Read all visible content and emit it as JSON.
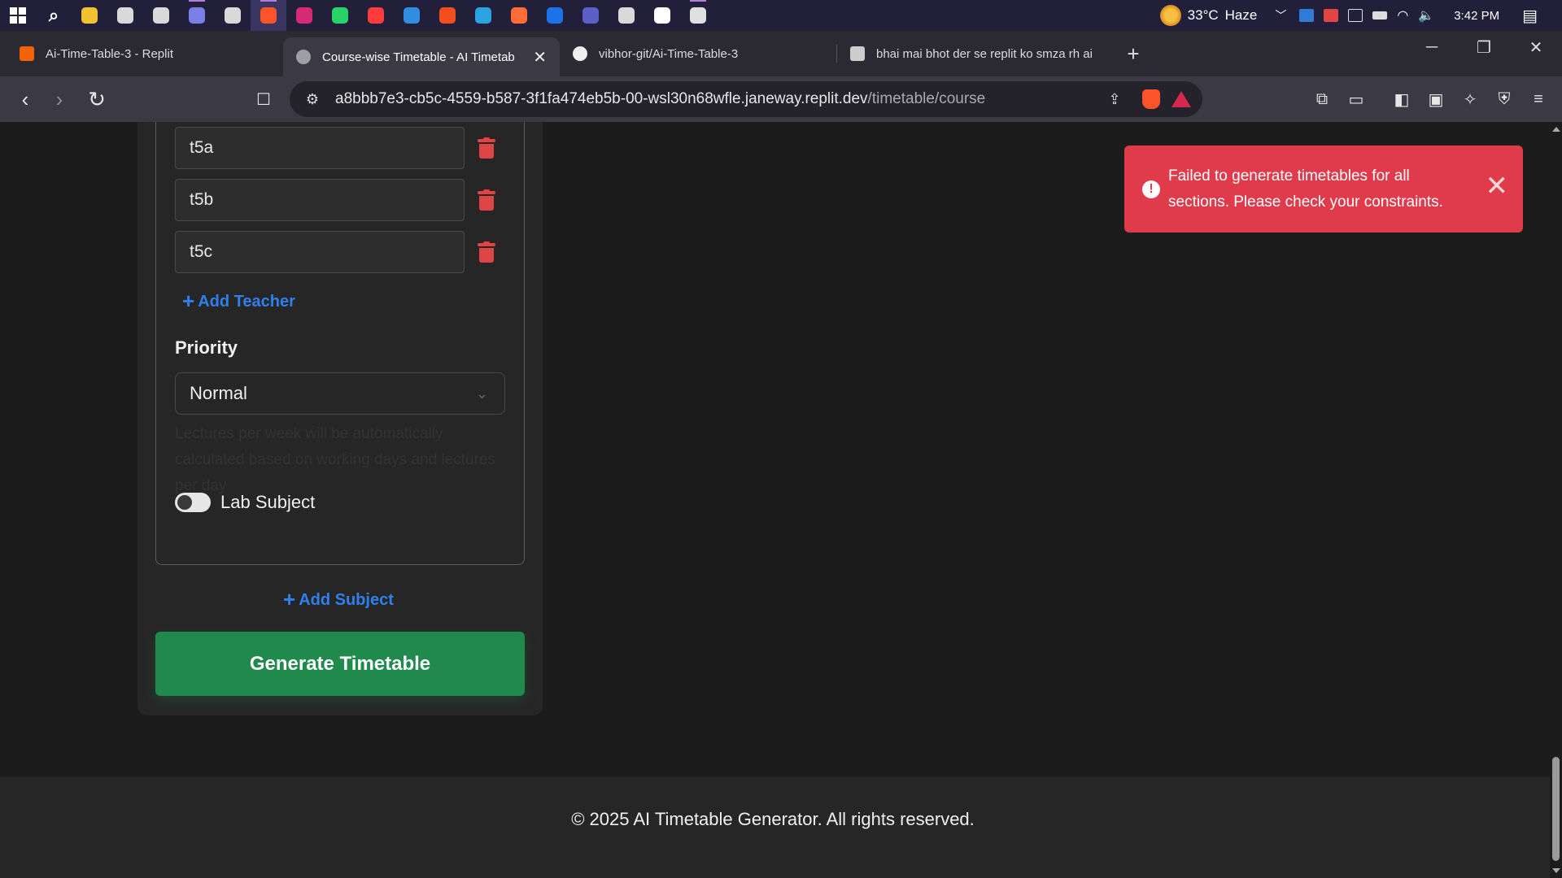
{
  "taskbar": {
    "apps": [
      {
        "name": "windows-start-icon"
      },
      {
        "name": "search-icon"
      },
      {
        "name": "file-explorer-icon",
        "color": "#f2c230"
      },
      {
        "name": "chatgpt-app-icon",
        "color": "#d9d9d9"
      },
      {
        "name": "copilot-app-icon",
        "color": "#d9d9d9"
      },
      {
        "name": "discord-app-icon",
        "color": "#7a7fe6"
      },
      {
        "name": "github-app-icon",
        "color": "#d9d9d9"
      },
      {
        "name": "brave-browser-icon",
        "color": "#fb542b"
      },
      {
        "name": "instagram-icon",
        "color": "#d62976"
      },
      {
        "name": "whatsapp-icon",
        "color": "#25d366"
      },
      {
        "name": "youtube-icon",
        "color": "#ff3b3b"
      },
      {
        "name": "vscode-icon",
        "color": "#2f8ee0"
      },
      {
        "name": "figma-icon",
        "color": "#f24e1e"
      },
      {
        "name": "telegram-icon",
        "color": "#2aa3e0"
      },
      {
        "name": "postman-icon",
        "color": "#ff6c37"
      },
      {
        "name": "outlook-icon",
        "color": "#1a73e8"
      },
      {
        "name": "teams-icon",
        "color": "#5b5fc7"
      },
      {
        "name": "copilot-web-icon",
        "color": "#d9d9d9"
      },
      {
        "name": "x-twitter-icon",
        "color": "#ffffff"
      },
      {
        "name": "git-icon",
        "color": "#e0e0e0"
      }
    ],
    "weather": {
      "temp": "33°C",
      "cond": "Haze"
    },
    "clock": "3:42 PM"
  },
  "tabs": [
    {
      "title": "Ai-Time-Table-3 - Replit",
      "fav_color": "#f26207",
      "icon": "replit-favicon"
    },
    {
      "title": "Course-wise Timetable - AI Timetab",
      "fav_color": "#9aa0a6",
      "icon": "globe-favicon",
      "close": "✕"
    },
    {
      "title": "vibhor-git/Ai-Time-Table-3",
      "fav_color": "#f0f0f0",
      "icon": "github-favicon"
    },
    {
      "title": "bhai mai bhot der se replit ko smza rh ai",
      "fav_color": "#cccccc",
      "icon": "chatgpt-favicon"
    }
  ],
  "new_tab": "+",
  "window_controls": {
    "minimize": "─",
    "restore": "❐",
    "close": "✕"
  },
  "nav": {
    "back": "‹",
    "forward": "›",
    "reload": "↻",
    "bookmark": "🔖"
  },
  "address": {
    "host": "a8bbb7e3-cb5c-4559-b587-3f1fa474eb5b-00-wsl30n68wfle.janeway.replit.dev",
    "path": "/timetable/course"
  },
  "form": {
    "teachers": [
      "t5a",
      "t5b",
      "t5c"
    ],
    "add_teacher": "Add Teacher",
    "priority_label": "Priority",
    "priority_value": "Normal",
    "hint": "Lectures per week will be automatically calculated based on working days and lectures per day",
    "lab_label": "Lab Subject",
    "lab_enabled": false,
    "add_subject": "Add Subject",
    "generate": "Generate Timetable"
  },
  "toast": {
    "message": "Failed to generate timetables for all sections. Please check your constraints.",
    "color": "#e03b4b"
  },
  "footer": "© 2025 AI Timetable Generator. All rights reserved."
}
